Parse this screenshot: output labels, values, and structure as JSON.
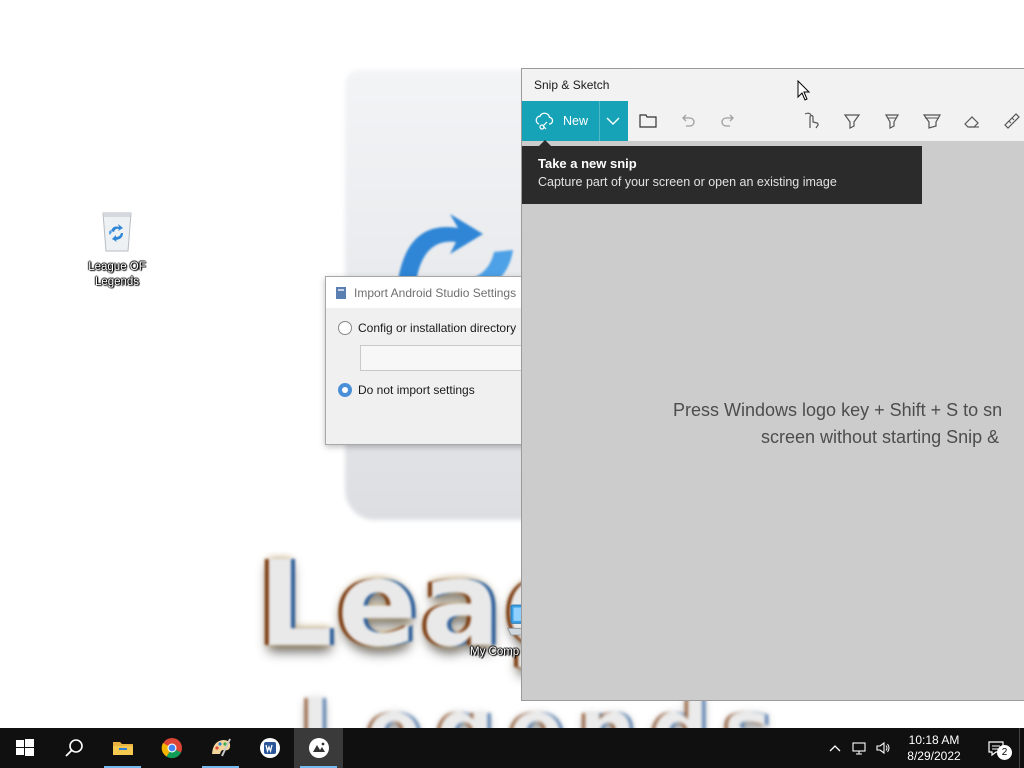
{
  "desktop": {
    "wallpaper_text_1": "League",
    "wallpaper_text_2": "Legends",
    "icons": [
      {
        "label": "League OF Legends",
        "icon": "recycle-bin-icon"
      },
      {
        "label": "My Comp",
        "icon": "computer-icon"
      }
    ]
  },
  "import_dialog": {
    "title": "Import Android Studio Settings",
    "option_config": "Config or installation directory",
    "path_value": "",
    "option_no_import": "Do not import settings",
    "selected": "Do not import settings"
  },
  "snip": {
    "title": "Snip & Sketch",
    "new_label": "New",
    "tools": [
      "open-file-icon",
      "undo-icon",
      "redo-icon",
      "touch-writing-icon",
      "ballpoint-pen-icon",
      "pencil-icon",
      "highlighter-icon",
      "eraser-icon",
      "ruler-icon"
    ],
    "tooltip_title": "Take a new snip",
    "tooltip_desc": "Capture part of your screen or open an existing image",
    "hint_line1": "Press Windows logo key + Shift + S to sn",
    "hint_line2": "screen without starting Snip &"
  },
  "taskbar": {
    "apps": [
      "start-icon",
      "search-icon",
      "file-explorer-icon",
      "chrome-icon",
      "paint-app-icon",
      "word-app-icon",
      "snip-sketch-icon"
    ],
    "time": "10:18 AM",
    "date": "8/29/2022",
    "notification_count": "2"
  },
  "colors": {
    "snip_accent": "#16a3b8",
    "taskbar": "#101010",
    "tooltip": "#2b2b2b"
  }
}
